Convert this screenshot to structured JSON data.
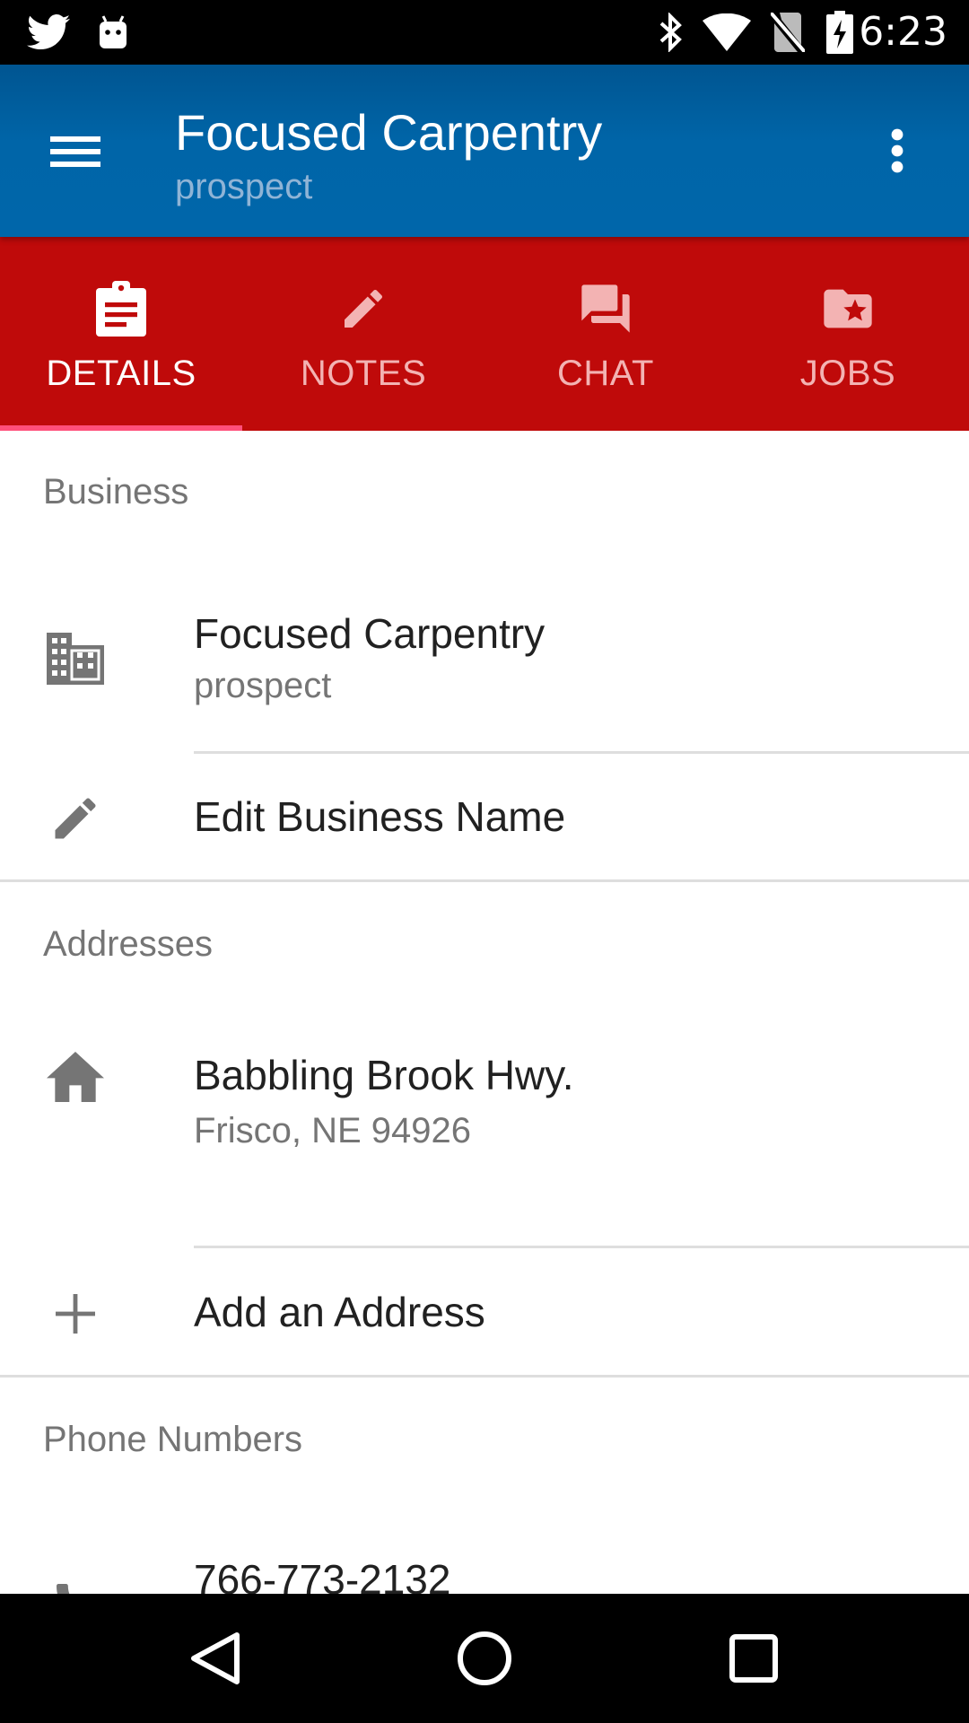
{
  "status_bar": {
    "time": "6:23",
    "icons": [
      "twitter-icon",
      "android-icon",
      "bluetooth-icon",
      "wifi-icon",
      "no-sim-icon",
      "battery-charging-icon"
    ]
  },
  "app_bar": {
    "title": "Focused Carpentry",
    "subtitle": "prospect",
    "menu_icon": "hamburger-menu-icon",
    "overflow_icon": "more-vert-icon"
  },
  "tabs": [
    {
      "label": "DETAILS",
      "icon": "clipboard-icon",
      "active": true
    },
    {
      "label": "NOTES",
      "icon": "pencil-icon",
      "active": false
    },
    {
      "label": "CHAT",
      "icon": "forum-icon",
      "active": false
    },
    {
      "label": "JOBS",
      "icon": "folder-star-icon",
      "active": false
    }
  ],
  "business": {
    "header": "Business",
    "name": "Focused Carpentry",
    "status": "prospect",
    "edit_label": "Edit Business Name"
  },
  "addresses": {
    "header": "Addresses",
    "items": [
      {
        "line1": "Babbling Brook Hwy.",
        "line2": "Frisco, NE 94926"
      }
    ],
    "add_label": "Add an Address"
  },
  "phones": {
    "header": "Phone Numbers",
    "items": [
      {
        "number": "766-773-2132"
      }
    ]
  },
  "colors": {
    "app_bar": "#0066aa",
    "tab_bar": "#bf0a0a",
    "tab_indicator": "#ff4f7a",
    "icon_gray": "#757575"
  }
}
